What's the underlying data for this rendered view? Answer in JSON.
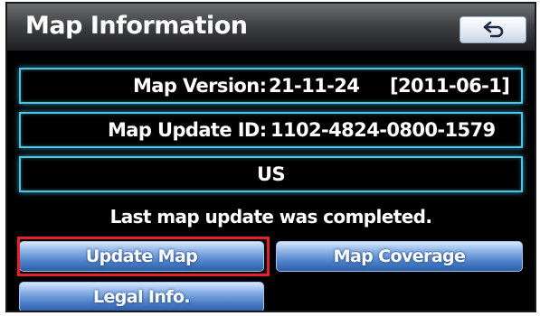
{
  "header": {
    "title": "Map Information",
    "back_icon": "return-arrow-icon"
  },
  "info": {
    "map_version_label": "Map Version:",
    "map_version_value": "21-11-24",
    "map_version_date": "[2011-06-1]",
    "map_update_id_label": "Map Update ID:",
    "map_update_id_value": "1102-4824-0800-1579",
    "region": "US"
  },
  "status": {
    "message": "Last map update was completed."
  },
  "buttons": {
    "update_map": "Update Map",
    "map_coverage": "Map Coverage",
    "legal_info": "Legal Info."
  },
  "colors": {
    "frame_accent": "#4fc4e6",
    "button_blue": "#4a7fc7",
    "highlight_red": "#e8202a"
  }
}
